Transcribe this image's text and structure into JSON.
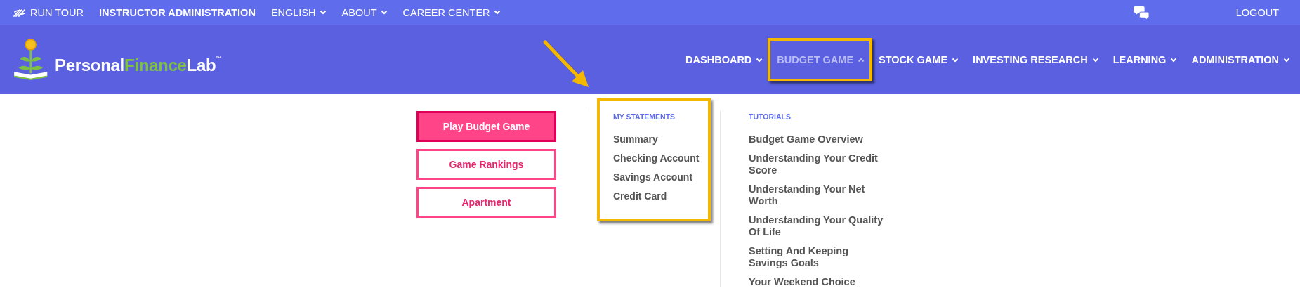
{
  "top_bar": {
    "items": [
      {
        "label": "RUN TOUR",
        "kind": "tour",
        "dropdown": false
      },
      {
        "label": "INSTRUCTOR ADMINISTRATION",
        "kind": "bold",
        "dropdown": false
      },
      {
        "label": "ENGLISH",
        "kind": "plain",
        "dropdown": true
      },
      {
        "label": "ABOUT",
        "kind": "plain",
        "dropdown": true
      },
      {
        "label": "CAREER CENTER",
        "kind": "plain",
        "dropdown": true
      }
    ],
    "logout": "LOGOUT"
  },
  "logo": {
    "parts": [
      "Personal",
      "Finance",
      "Lab"
    ],
    "mark": "™"
  },
  "nav": [
    {
      "label": "DASHBOARD",
      "expanded": false
    },
    {
      "label": "BUDGET GAME",
      "expanded": true
    },
    {
      "label": "STOCK GAME",
      "expanded": false
    },
    {
      "label": "INVESTING RESEARCH",
      "expanded": false
    },
    {
      "label": "LEARNING",
      "expanded": false
    },
    {
      "label": "ADMINISTRATION",
      "expanded": false
    }
  ],
  "menu": {
    "buttons": [
      {
        "label": "Play Budget Game",
        "kind": "primary"
      },
      {
        "label": "Game Rankings",
        "kind": "outline"
      },
      {
        "label": "Apartment",
        "kind": "outline"
      }
    ],
    "statements": {
      "heading": "MY STATEMENTS",
      "items": [
        "Summary",
        "Checking Account",
        "Savings Account",
        "Credit Card"
      ]
    },
    "tutorials": {
      "heading": "TUTORIALS",
      "items": [
        "Budget Game Overview",
        "Understanding Your Credit Score",
        "Understanding Your Net Worth",
        "Understanding Your Quality Of Life",
        "Setting And Keeping Savings Goals",
        "Your Weekend Choice"
      ]
    }
  }
}
